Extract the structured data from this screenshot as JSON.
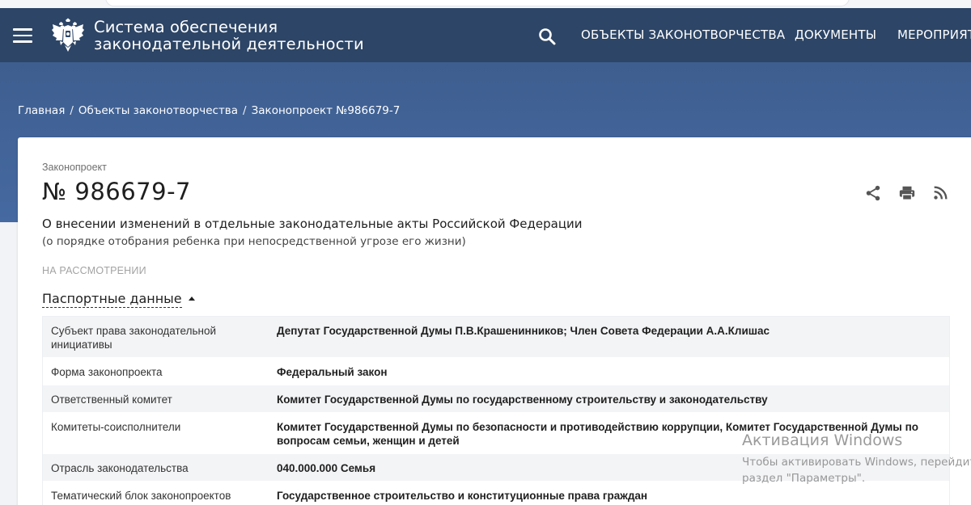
{
  "header": {
    "title_line1": "Система обеспечения",
    "title_line2": "законодательной деятельности",
    "nav": [
      {
        "label": "ОБЪЕКТЫ ЗАКОНОТВОРЧЕСТВА"
      },
      {
        "label": "ДОКУМЕНТЫ"
      },
      {
        "label": "МЕРОПРИЯТ"
      }
    ],
    "icons": {
      "menu": "hamburger-menu-icon",
      "emblem": "russian-coat-of-arms-emblem",
      "search": "search-icon"
    }
  },
  "breadcrumb": [
    {
      "label": "Главная"
    },
    {
      "label": "Объекты законотворчества"
    },
    {
      "label": "Законопроект №986679-7"
    }
  ],
  "breadcrumb_separator": "/",
  "bill": {
    "kind": "Законопроект",
    "number": "№ 986679-7",
    "title": "О внесении изменений в отдельные законодательные акты Российской Федерации",
    "subtitle": "(о порядке отобрания ребенка при непосредственной угрозе его жизни)",
    "status": "НА РАССМОТРЕНИИ",
    "actions": [
      "share-icon",
      "print-icon",
      "rss-icon"
    ]
  },
  "passport": {
    "toggle_label": "Паспортные данные",
    "rows": [
      {
        "key": "Субъект права законодательной инициативы",
        "value": "Депутат Государственной Думы П.В.Крашенинников; Член Совета Федерации А.А.Клишас"
      },
      {
        "key": "Форма законопроекта",
        "value": "Федеральный закон"
      },
      {
        "key": "Ответственный комитет",
        "value": "Комитет Государственной Думы по государственному строительству и законодательству"
      },
      {
        "key": "Комитеты-соисполнители",
        "value": "Комитет Государственной Думы по безопасности и противодействию коррупции, Комитет Государственной Думы по вопросам семьи, женщин и детей"
      },
      {
        "key": "Отрасль законодательства",
        "value": "040.000.000 Семья"
      },
      {
        "key": "Тематический блок законопроектов",
        "value": "Государственное строительство и конституционные права граждан"
      }
    ]
  },
  "watermark": {
    "line1": "Активация Windows",
    "line2": "Чтобы активировать Windows, перейдите",
    "line3": "раздел \"Параметры\"."
  },
  "colors": {
    "header_bg": "#2d4566",
    "band_bg": "#4569a1",
    "row_shade": "#f3f4f6"
  }
}
